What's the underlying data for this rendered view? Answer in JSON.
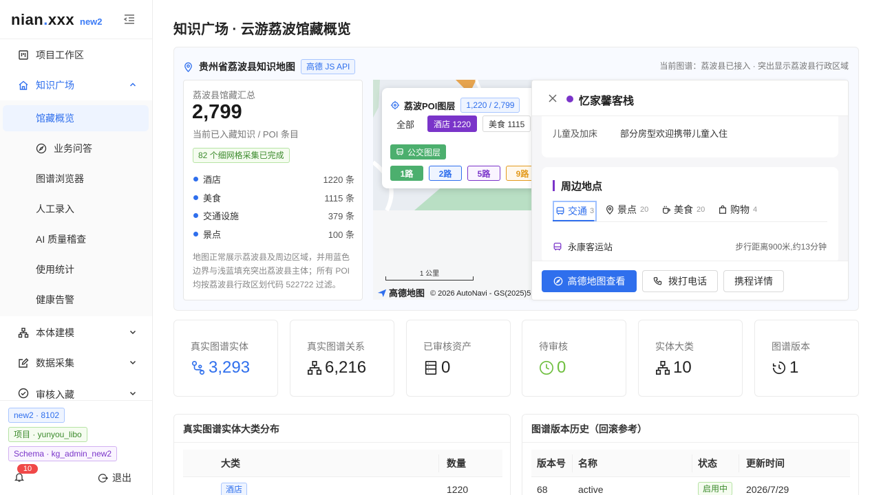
{
  "app": {
    "logo_main": "nian",
    "logo_dot": ".",
    "logo_tail": "xxx",
    "logo_badge": "new2"
  },
  "sidebar": {
    "items": [
      {
        "label": "项目工作区",
        "icon": "kanban-icon"
      },
      {
        "label": "知识广场",
        "icon": "home-icon"
      },
      {
        "label": "馆藏概览"
      },
      {
        "label": "业务问答",
        "icon": "compass-icon"
      },
      {
        "label": "图谱浏览器"
      },
      {
        "label": "人工录入"
      },
      {
        "label": "AI 质量稽查"
      },
      {
        "label": "使用统计"
      },
      {
        "label": "健康告警"
      },
      {
        "label": "本体建模",
        "icon": "sitemap-icon"
      },
      {
        "label": "数据采集",
        "icon": "edit-icon"
      },
      {
        "label": "审核入藏",
        "icon": "check-circle-icon"
      }
    ],
    "tags": [
      "new2 · 8102",
      "项目 · yunyou_libo",
      "Schema · kg_admin_new2"
    ],
    "bell_count": "10",
    "logout": "退出"
  },
  "page": {
    "title": "知识广场 · 云游荔波馆藏概览"
  },
  "map": {
    "title": "贵州省荔波县知识地图",
    "api_tag": "高德 JS API",
    "status": "当前图谱：荔波县已接入 · 突出显示荔波县行政区域",
    "summary": {
      "label": "荔波县馆藏汇总",
      "total": "2,799",
      "sub": "当前已入藏知识 / POI 条目",
      "grid_tag": "82 个细网格采集已完成",
      "legend": [
        {
          "name": "酒店",
          "count": "1220 条"
        },
        {
          "name": "美食",
          "count": "1115 条"
        },
        {
          "name": "交通设施",
          "count": "379 条"
        },
        {
          "name": "景点",
          "count": "100 条"
        }
      ],
      "note": "地图正常展示荔波县及周边区域，并用蓝色边界与浅蓝填充突出荔波县主体；所有 POI 均按荔波县行政区划代码 522722 过滤。"
    },
    "poi_layer": {
      "title": "荔波POI图层",
      "count": "1,220 / 2,799",
      "filters": [
        "全部",
        "酒店 1220",
        "美食 1115"
      ],
      "bus_label": "公交图层",
      "routes": [
        "1路",
        "2路",
        "5路",
        "9路"
      ]
    },
    "scale": "1 公里",
    "provider": "高德地图",
    "copyright": "© 2026 AutoNavi - GS(2025)5996号",
    "detail": {
      "name": "忆家馨客栈",
      "row_key": "儿童及加床",
      "row_val": "部分房型欢迎携带儿童入住",
      "nearby_title": "周边地点",
      "tabs": [
        {
          "label": "交通",
          "count": "3"
        },
        {
          "label": "景点",
          "count": "20"
        },
        {
          "label": "美食",
          "count": "20"
        },
        {
          "label": "购物",
          "count": "4"
        }
      ],
      "nearby_item": "永康客运站",
      "nearby_dist": "步行距离900米,约13分钟",
      "btn_map": "高德地图查看",
      "btn_call": "拨打电话",
      "btn_trip": "携程详情"
    }
  },
  "stats": [
    {
      "label": "真实图谱实体",
      "value": "3,293"
    },
    {
      "label": "真实图谱关系",
      "value": "6,216"
    },
    {
      "label": "已审核资产",
      "value": "0"
    },
    {
      "label": "待审核",
      "value": "0"
    },
    {
      "label": "实体大类",
      "value": "10"
    },
    {
      "label": "图谱版本",
      "value": "1"
    }
  ],
  "entity_panel": {
    "title": "真实图谱实体大类分布",
    "headers": [
      "大类",
      "数量"
    ],
    "rows": [
      {
        "category": "酒店",
        "count": "1220"
      }
    ]
  },
  "version_panel": {
    "title": "图谱版本历史（回滚参考）",
    "headers": [
      "版本号",
      "名称",
      "状态",
      "更新时间"
    ],
    "rows": [
      {
        "version": "68",
        "name": "active",
        "status": "启用中",
        "time": "2026/7/29"
      }
    ]
  },
  "colors": {
    "accent": "#2f6fed",
    "purple": "#7a34c9",
    "green": "#4caf6e",
    "orange": "#e39a1c"
  }
}
